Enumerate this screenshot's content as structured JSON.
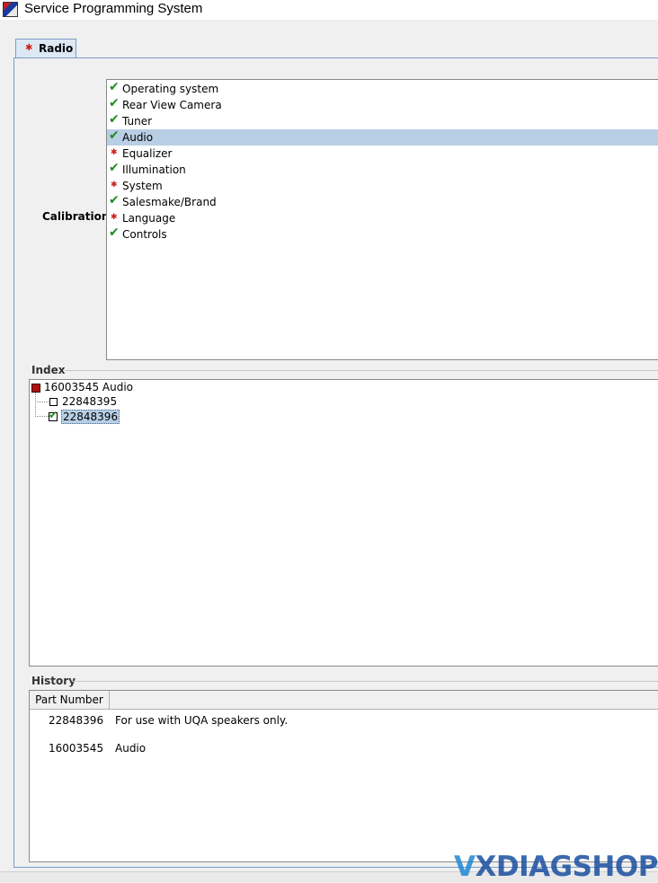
{
  "window": {
    "title": "Service Programming System",
    "icon": "app-icon"
  },
  "tabs": [
    {
      "label": "Radio",
      "status": "error",
      "icon": "red-star-icon"
    }
  ],
  "calibration": {
    "label": "Calibration",
    "selected_index": 3,
    "items": [
      {
        "label": "Operating system",
        "status": "ok"
      },
      {
        "label": "Rear View Camera",
        "status": "ok"
      },
      {
        "label": "Tuner",
        "status": "ok"
      },
      {
        "label": "Audio",
        "status": "ok"
      },
      {
        "label": "Equalizer",
        "status": "error"
      },
      {
        "label": "Illumination",
        "status": "ok"
      },
      {
        "label": "System",
        "status": "error"
      },
      {
        "label": "Salesmake/Brand",
        "status": "ok"
      },
      {
        "label": "Language",
        "status": "error"
      },
      {
        "label": "Controls",
        "status": "ok"
      }
    ]
  },
  "index": {
    "label": "Index",
    "root": {
      "label": "16003545 Audio"
    },
    "children": [
      {
        "label": "22848395",
        "checked": false
      },
      {
        "label": "22848396",
        "checked": true,
        "selected": true
      }
    ]
  },
  "history": {
    "label": "History",
    "columns": [
      "Part Number",
      ""
    ],
    "rows": [
      {
        "part_number": "22848396",
        "description": "For use with UQA speakers only."
      },
      {
        "part_number": "16003545",
        "description": "Audio"
      }
    ]
  },
  "watermark": {
    "prefix": "V",
    "text": "XDIAGSHOP"
  },
  "colors": {
    "ok": "#1f8c1f",
    "error": "#c81e1e",
    "selection": "#b8cfe5",
    "border_accent": "#7a9cc6"
  }
}
